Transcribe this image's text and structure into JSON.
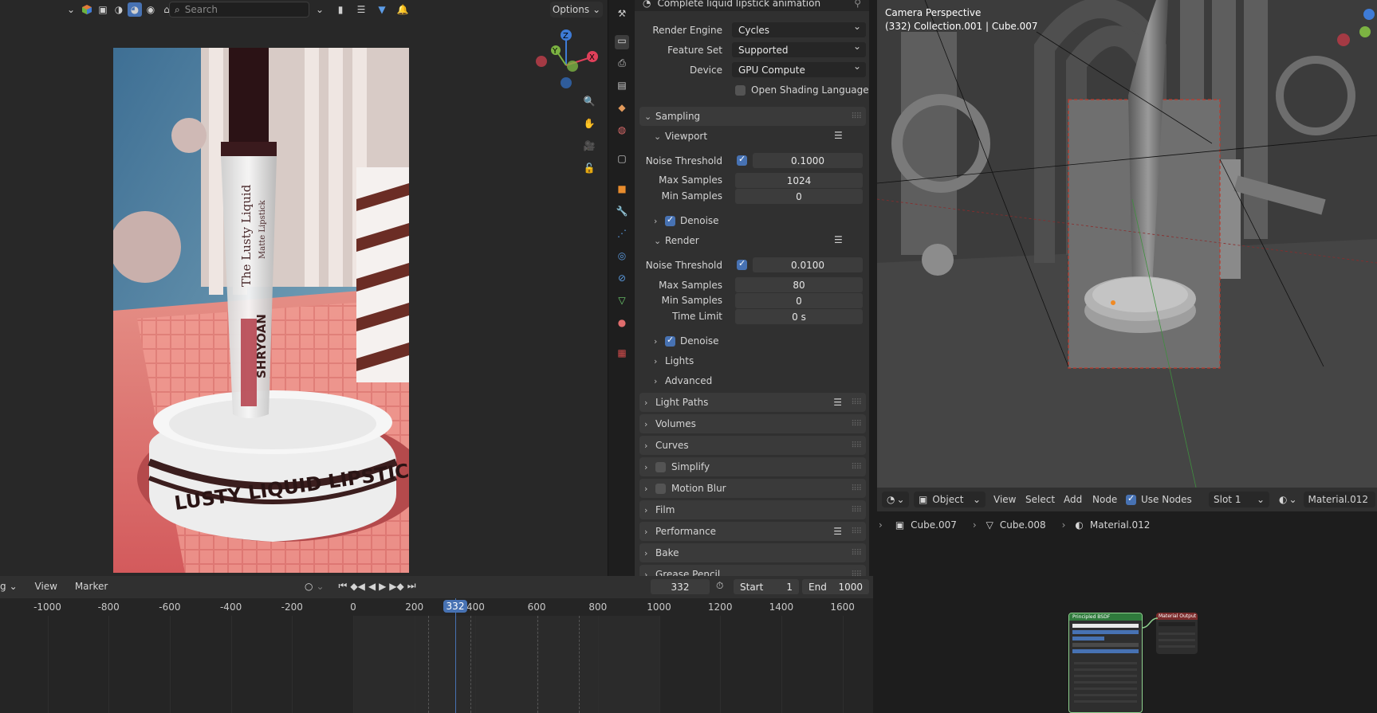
{
  "header": {
    "search_placeholder": "Search",
    "options_label": "Options"
  },
  "render_image": {
    "lipstick_brand": "The Lusty Liquid",
    "lipstick_sub": "Matte Lipstick",
    "brand_name": "SHRYOAN",
    "base_text": "LUSTY LIQUID LIPSTICK"
  },
  "properties": {
    "top_title": "Complete liquid lipstick animation",
    "render_engine_label": "Render Engine",
    "render_engine_value": "Cycles",
    "feature_set_label": "Feature Set",
    "feature_set_value": "Supported",
    "device_label": "Device",
    "device_value": "GPU Compute",
    "osl_label": "Open Shading Language",
    "sampling": {
      "title": "Sampling",
      "viewport": {
        "title": "Viewport",
        "noise_threshold_label": "Noise Threshold",
        "noise_threshold_value": "0.1000",
        "max_samples_label": "Max Samples",
        "max_samples_value": "1024",
        "min_samples_label": "Min Samples",
        "min_samples_value": "0",
        "denoise_label": "Denoise"
      },
      "render": {
        "title": "Render",
        "noise_threshold_label": "Noise Threshold",
        "noise_threshold_value": "0.0100",
        "max_samples_label": "Max Samples",
        "max_samples_value": "80",
        "min_samples_label": "Min Samples",
        "min_samples_value": "0",
        "time_limit_label": "Time Limit",
        "time_limit_value": "0 s",
        "denoise_label": "Denoise"
      },
      "lights_label": "Lights",
      "advanced_label": "Advanced"
    },
    "panels": [
      "Light Paths",
      "Volumes",
      "Curves",
      "Simplify",
      "Motion Blur",
      "Film",
      "Performance",
      "Bake",
      "Grease Pencil"
    ]
  },
  "viewport": {
    "title_line1": "Camera Perspective",
    "title_line2": "(332) Collection.001 | Cube.007"
  },
  "node_editor": {
    "mode": "Object",
    "menu": [
      "View",
      "Select",
      "Add",
      "Node"
    ],
    "use_nodes_label": "Use Nodes",
    "slot_label": "Slot 1",
    "material_name": "Material.012",
    "breadcrumb": [
      "Cube.007",
      "Cube.008",
      "Material.012"
    ],
    "node_bsdf_title": "Principled BSDF",
    "node_output_title": "Material Output"
  },
  "timeline": {
    "menu_partial": "g",
    "view_label": "View",
    "marker_label": "Marker",
    "current_frame": "332",
    "start_label": "Start",
    "start_value": "1",
    "end_label": "End",
    "end_value": "1000",
    "ticks": [
      "-1000",
      "-800",
      "-600",
      "-400",
      "-200",
      "0",
      "200",
      "400",
      "600",
      "800",
      "1000",
      "1200",
      "1400",
      "1600"
    ]
  },
  "colors": {
    "accent": "#4772b3",
    "axis_x": "#e0405a",
    "axis_y": "#7cb342",
    "axis_z": "#3e7bd6"
  }
}
